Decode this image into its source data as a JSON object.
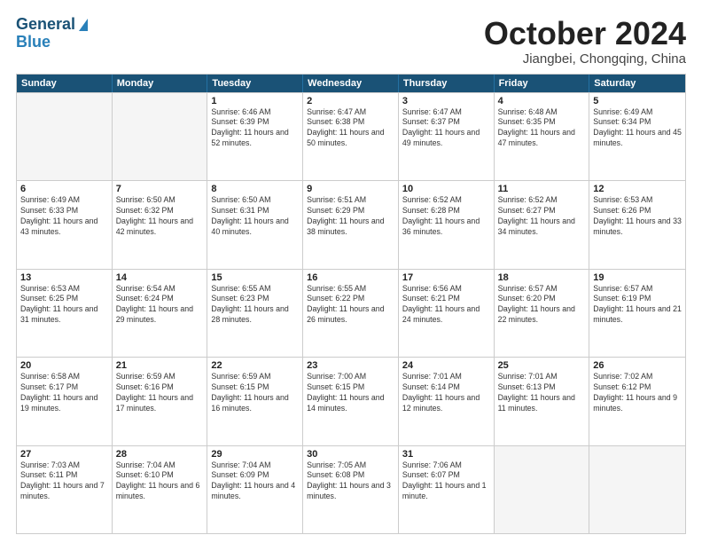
{
  "header": {
    "logo_general": "General",
    "logo_blue": "Blue",
    "title": "October 2024",
    "location": "Jiangbei, Chongqing, China"
  },
  "days_of_week": [
    "Sunday",
    "Monday",
    "Tuesday",
    "Wednesday",
    "Thursday",
    "Friday",
    "Saturday"
  ],
  "weeks": [
    [
      {
        "day": "",
        "empty": true
      },
      {
        "day": "",
        "empty": true
      },
      {
        "day": "1",
        "rise": "6:46 AM",
        "set": "6:39 PM",
        "daylight": "11 hours and 52 minutes."
      },
      {
        "day": "2",
        "rise": "6:47 AM",
        "set": "6:38 PM",
        "daylight": "11 hours and 50 minutes."
      },
      {
        "day": "3",
        "rise": "6:47 AM",
        "set": "6:37 PM",
        "daylight": "11 hours and 49 minutes."
      },
      {
        "day": "4",
        "rise": "6:48 AM",
        "set": "6:35 PM",
        "daylight": "11 hours and 47 minutes."
      },
      {
        "day": "5",
        "rise": "6:49 AM",
        "set": "6:34 PM",
        "daylight": "11 hours and 45 minutes."
      }
    ],
    [
      {
        "day": "6",
        "rise": "6:49 AM",
        "set": "6:33 PM",
        "daylight": "11 hours and 43 minutes."
      },
      {
        "day": "7",
        "rise": "6:50 AM",
        "set": "6:32 PM",
        "daylight": "11 hours and 42 minutes."
      },
      {
        "day": "8",
        "rise": "6:50 AM",
        "set": "6:31 PM",
        "daylight": "11 hours and 40 minutes."
      },
      {
        "day": "9",
        "rise": "6:51 AM",
        "set": "6:29 PM",
        "daylight": "11 hours and 38 minutes."
      },
      {
        "day": "10",
        "rise": "6:52 AM",
        "set": "6:28 PM",
        "daylight": "11 hours and 36 minutes."
      },
      {
        "day": "11",
        "rise": "6:52 AM",
        "set": "6:27 PM",
        "daylight": "11 hours and 34 minutes."
      },
      {
        "day": "12",
        "rise": "6:53 AM",
        "set": "6:26 PM",
        "daylight": "11 hours and 33 minutes."
      }
    ],
    [
      {
        "day": "13",
        "rise": "6:53 AM",
        "set": "6:25 PM",
        "daylight": "11 hours and 31 minutes."
      },
      {
        "day": "14",
        "rise": "6:54 AM",
        "set": "6:24 PM",
        "daylight": "11 hours and 29 minutes."
      },
      {
        "day": "15",
        "rise": "6:55 AM",
        "set": "6:23 PM",
        "daylight": "11 hours and 28 minutes."
      },
      {
        "day": "16",
        "rise": "6:55 AM",
        "set": "6:22 PM",
        "daylight": "11 hours and 26 minutes."
      },
      {
        "day": "17",
        "rise": "6:56 AM",
        "set": "6:21 PM",
        "daylight": "11 hours and 24 minutes."
      },
      {
        "day": "18",
        "rise": "6:57 AM",
        "set": "6:20 PM",
        "daylight": "11 hours and 22 minutes."
      },
      {
        "day": "19",
        "rise": "6:57 AM",
        "set": "6:19 PM",
        "daylight": "11 hours and 21 minutes."
      }
    ],
    [
      {
        "day": "20",
        "rise": "6:58 AM",
        "set": "6:17 PM",
        "daylight": "11 hours and 19 minutes."
      },
      {
        "day": "21",
        "rise": "6:59 AM",
        "set": "6:16 PM",
        "daylight": "11 hours and 17 minutes."
      },
      {
        "day": "22",
        "rise": "6:59 AM",
        "set": "6:15 PM",
        "daylight": "11 hours and 16 minutes."
      },
      {
        "day": "23",
        "rise": "7:00 AM",
        "set": "6:15 PM",
        "daylight": "11 hours and 14 minutes."
      },
      {
        "day": "24",
        "rise": "7:01 AM",
        "set": "6:14 PM",
        "daylight": "11 hours and 12 minutes."
      },
      {
        "day": "25",
        "rise": "7:01 AM",
        "set": "6:13 PM",
        "daylight": "11 hours and 11 minutes."
      },
      {
        "day": "26",
        "rise": "7:02 AM",
        "set": "6:12 PM",
        "daylight": "11 hours and 9 minutes."
      }
    ],
    [
      {
        "day": "27",
        "rise": "7:03 AM",
        "set": "6:11 PM",
        "daylight": "11 hours and 7 minutes."
      },
      {
        "day": "28",
        "rise": "7:04 AM",
        "set": "6:10 PM",
        "daylight": "11 hours and 6 minutes."
      },
      {
        "day": "29",
        "rise": "7:04 AM",
        "set": "6:09 PM",
        "daylight": "11 hours and 4 minutes."
      },
      {
        "day": "30",
        "rise": "7:05 AM",
        "set": "6:08 PM",
        "daylight": "11 hours and 3 minutes."
      },
      {
        "day": "31",
        "rise": "7:06 AM",
        "set": "6:07 PM",
        "daylight": "11 hours and 1 minute."
      },
      {
        "day": "",
        "empty": true
      },
      {
        "day": "",
        "empty": true
      }
    ]
  ]
}
